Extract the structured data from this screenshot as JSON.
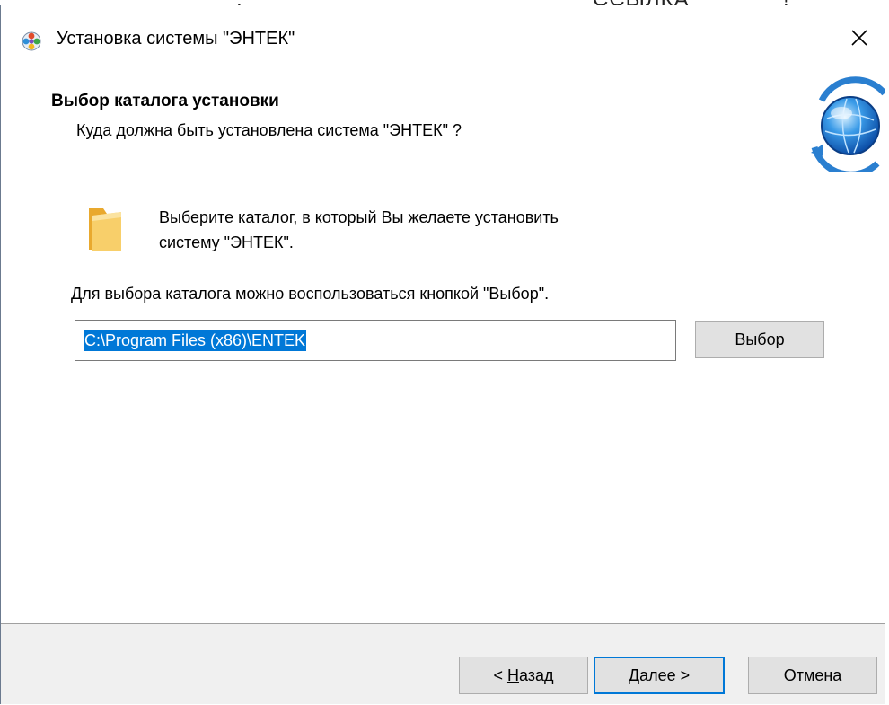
{
  "top_clipped": {
    "left_glyph": ",",
    "right_glyph": "ССЫЛКА",
    "right_glyph_2": "!"
  },
  "window": {
    "title": "Установка системы \"ЭНТЕК\"",
    "close_symbol": "✕"
  },
  "header": {
    "title": "Выбор каталога установки",
    "subtitle": "Куда должна быть установлена система \"ЭНТЕК\" ?"
  },
  "body": {
    "info_line1": "Выберите каталог, в который Вы желаете установить",
    "info_line2": "систему \"ЭНТЕК\".",
    "hint": "Для выбора каталога можно воспользоваться кнопкой \"Выбор\".",
    "path_value": "C:\\Program Files (x86)\\ENTEK",
    "browse_label": "Выбор"
  },
  "footer": {
    "back_prefix": "< ",
    "back_accel": "Н",
    "back_rest": "азад",
    "next_accel": "Д",
    "next_rest": "алее >",
    "cancel_label": "Отмена"
  },
  "colors": {
    "selection": "#0078d7",
    "default_button_border": "#0078d7",
    "footer_bg": "#f0f0f0",
    "button_bg": "#e1e1e1",
    "folder": "#f5c24c"
  },
  "icons": {
    "app": "setup-app-icon",
    "close": "close-icon",
    "globe": "globe-refresh-icon",
    "folder": "folder-icon"
  }
}
